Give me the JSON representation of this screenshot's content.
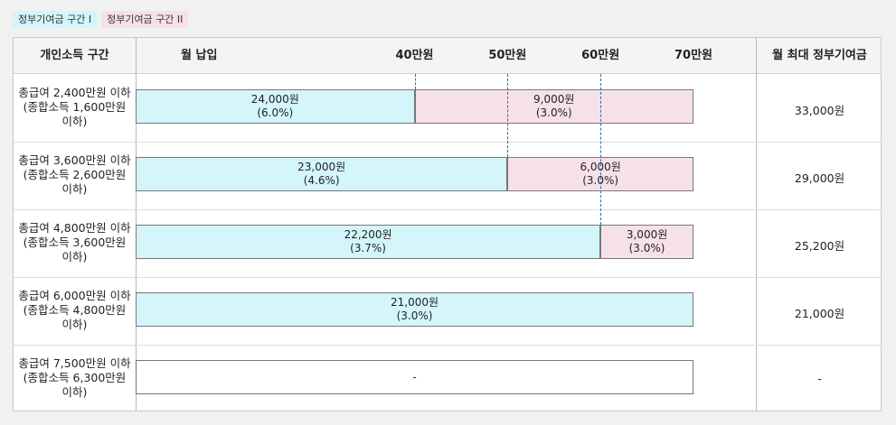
{
  "legend": {
    "tier1": "정부기여금 구간 I",
    "tier2": "정부기여금 구간 II"
  },
  "colors": {
    "tier1": "#d3f5fb",
    "tier2": "#f7e1e8",
    "empty": "#ffffff",
    "marker": "#2a6da8"
  },
  "header": {
    "income": "개인소득 구간",
    "monthly": "월 납입",
    "max_contribution": "월 최대 정부기여금"
  },
  "chart_data": {
    "type": "bar",
    "orientation": "horizontal-stacked",
    "x_unit": "만원",
    "ticks": [
      "40만원",
      "50만원",
      "60만원",
      "70만원"
    ],
    "tick_values": [
      40,
      50,
      60,
      70
    ],
    "xlim": [
      10,
      70
    ],
    "rows": [
      {
        "label": "총급여 2,400만원 이하\n(종합소득 1,600만원\n이하)",
        "segments": [
          {
            "tier": "tier1",
            "from": 10,
            "to": 40,
            "text": "24,000원\n(6.0%)"
          },
          {
            "tier": "tier2",
            "from": 40,
            "to": 70,
            "text": "9,000원\n(3.0%)"
          }
        ],
        "max": "33,000원"
      },
      {
        "label": "총급여 3,600만원 이하\n(종합소득 2,600만원\n이하)",
        "segments": [
          {
            "tier": "tier1",
            "from": 10,
            "to": 50,
            "text": "23,000원\n(4.6%)"
          },
          {
            "tier": "tier2",
            "from": 50,
            "to": 70,
            "text": "6,000원\n(3.0%)"
          }
        ],
        "max": "29,000원"
      },
      {
        "label": "총급여 4,800만원 이하\n(종합소득 3,600만원\n이하)",
        "segments": [
          {
            "tier": "tier1",
            "from": 10,
            "to": 60,
            "text": "22,200원\n(3.7%)"
          },
          {
            "tier": "tier2",
            "from": 60,
            "to": 70,
            "text": "3,000원\n(3.0%)"
          }
        ],
        "max": "25,200원"
      },
      {
        "label": "총급여 6,000만원 이하\n(종합소득 4,800만원\n이하)",
        "segments": [
          {
            "tier": "tier1",
            "from": 10,
            "to": 70,
            "text": "21,000원\n(3.0%)"
          }
        ],
        "max": "21,000원"
      },
      {
        "label": "총급여 7,500만원 이하\n(종합소득 6,300만원\n이하)",
        "segments": [
          {
            "tier": "empty",
            "from": 10,
            "to": 70,
            "text": "-"
          }
        ],
        "max": "-"
      }
    ]
  }
}
